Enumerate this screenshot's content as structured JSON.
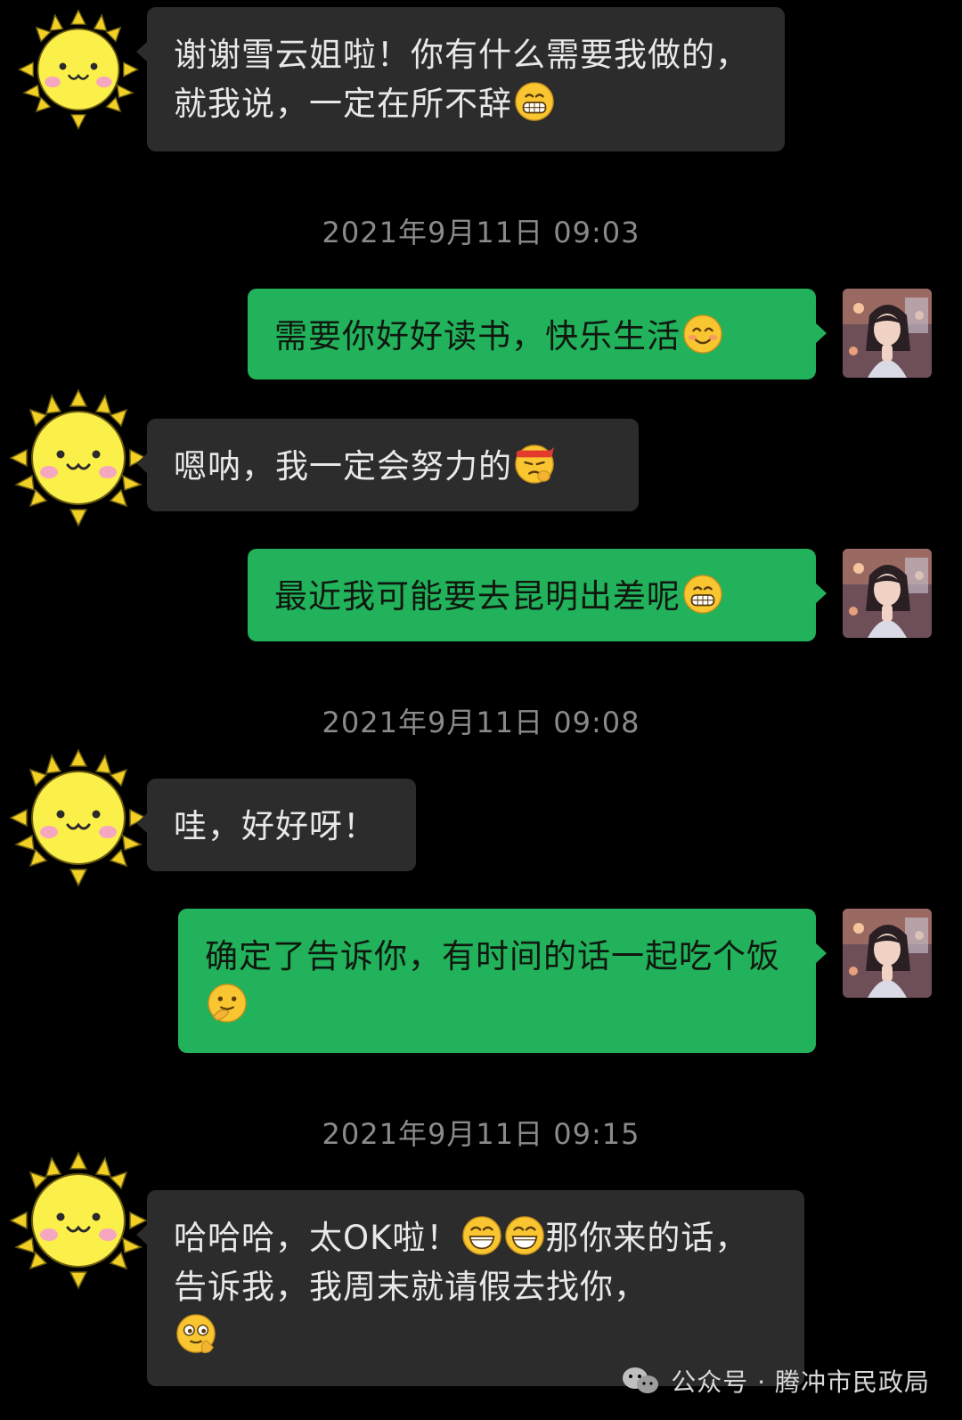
{
  "messages": [
    {
      "side": "in",
      "text": "谢谢雪云姐啦！你有什么需要我做的，就我说，一定在所不辞",
      "emoji": [
        "grin"
      ]
    },
    {
      "type": "timestamp",
      "text": "2021年9月11日 09:03"
    },
    {
      "side": "out",
      "text": "需要你好好读书，快乐生活",
      "emoji": [
        "smile"
      ]
    },
    {
      "side": "in",
      "text": "嗯呐，我一定会努力的",
      "emoji": [
        "determined"
      ]
    },
    {
      "side": "out",
      "text": "最近我可能要去昆明出差呢",
      "emoji": [
        "grin"
      ]
    },
    {
      "type": "timestamp",
      "text": "2021年9月11日 09:08"
    },
    {
      "side": "in",
      "text": "哇，好好呀！",
      "emoji": []
    },
    {
      "side": "out",
      "text": "确定了告诉你，有时间的话一起吃个饭",
      "emoji": [
        "hmm"
      ]
    },
    {
      "type": "timestamp",
      "text": "2021年9月11日 09:15"
    },
    {
      "side": "in",
      "text_before": "哈哈哈，太OK啦！",
      "text_after": "那你来的话，告诉我，我周末就请假去找你，",
      "emoji_mid": [
        "laugh",
        "laugh"
      ],
      "emoji_end": [
        "wink"
      ]
    }
  ],
  "avatars": {
    "incoming": "sun-sticker-avatar",
    "outgoing": "girl-photo-avatar"
  },
  "watermark": {
    "icon": "wechat-icon",
    "text": "公众号 · 腾冲市民政局"
  },
  "colors": {
    "background": "#000000",
    "incoming_bubble": "#2c2c2c",
    "outgoing_bubble": "#21b25b",
    "timestamp": "#8a8a8a"
  }
}
